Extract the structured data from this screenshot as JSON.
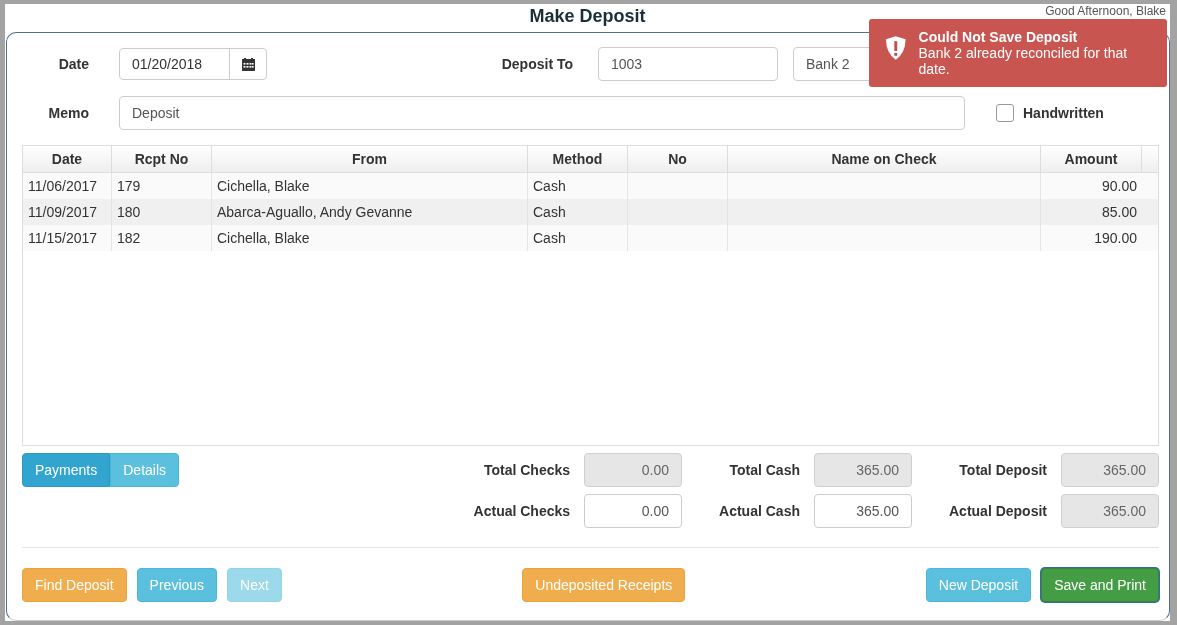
{
  "title": "Make Deposit",
  "header": {
    "greeting": "Good Afternoon, Blake"
  },
  "toast": {
    "title": "Could Not Save Deposit",
    "message": "Bank 2 already reconciled for that date."
  },
  "form": {
    "date_label": "Date",
    "date": "01/20/2018",
    "deposit_to_label": "Deposit To",
    "account": "1003",
    "bank": "Bank 2",
    "memo_label": "Memo",
    "memo": "Deposit",
    "handwritten": {
      "label": "Handwritten",
      "checked": false
    }
  },
  "table": {
    "columns": [
      "Date",
      "Rcpt No",
      "From",
      "Method",
      "No",
      "Name on Check",
      "Amount"
    ],
    "rows": [
      {
        "cells": [
          "11/06/2017",
          "179",
          "Cichella, Blake",
          "Cash",
          "",
          "",
          "90.00"
        ]
      },
      {
        "cells": [
          "11/09/2017",
          "180",
          "Abarca-Aguallo, Andy Gevanne",
          "Cash",
          "",
          "",
          "85.00"
        ]
      },
      {
        "cells": [
          "11/15/2017",
          "182",
          "Cichella, Blake",
          "Cash",
          "",
          "",
          "190.00"
        ]
      }
    ]
  },
  "tabs": [
    {
      "label": "Payments",
      "selected": true
    },
    {
      "label": "Details",
      "selected": false
    }
  ],
  "totals": [
    {
      "label": "Total Checks",
      "value": "0.00",
      "disabled": true
    },
    {
      "label": "Total Cash",
      "value": "365.00",
      "disabled": true
    },
    {
      "label": "Total Deposit",
      "value": "365.00",
      "disabled": true
    },
    {
      "label": "Actual Checks",
      "value": "0.00",
      "disabled": false
    },
    {
      "label": "Actual Cash",
      "value": "365.00",
      "disabled": false
    },
    {
      "label": "Actual Deposit",
      "value": "365.00",
      "disabled": true
    }
  ],
  "buttons_left": [
    {
      "label": "Find Deposit",
      "kind": "warning",
      "disabled": false
    },
    {
      "label": "Previous",
      "kind": "info",
      "disabled": false
    },
    {
      "label": "Next",
      "kind": "info",
      "disabled": true
    }
  ],
  "buttons_center": [
    {
      "label": "Undeposited Receipts",
      "kind": "warning",
      "disabled": false
    }
  ],
  "buttons_right": [
    {
      "label": "New Deposit",
      "kind": "info",
      "disabled": false
    },
    {
      "label": "Save and Print",
      "kind": "success",
      "disabled": false
    }
  ]
}
